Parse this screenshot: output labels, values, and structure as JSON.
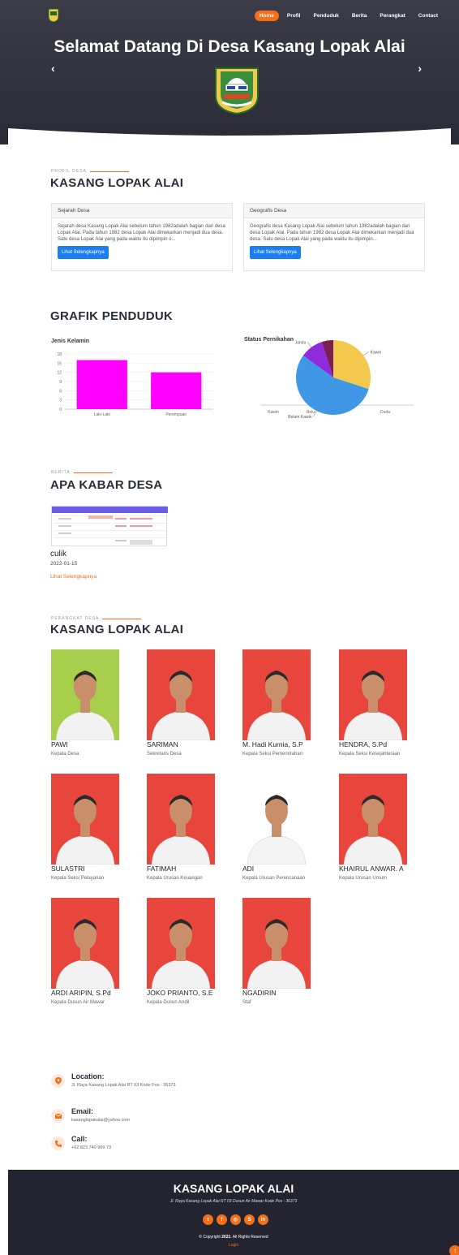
{
  "nav": {
    "items": [
      "Home",
      "Profil",
      "Penduduk",
      "Berita",
      "Perangkat",
      "Contact"
    ],
    "active": "Home"
  },
  "hero": {
    "title": "Selamat Datang Di Desa Kasang Lopak Alai",
    "prev_icon": "chevron-left-icon",
    "next_icon": "chevron-right-icon"
  },
  "profil": {
    "subtitle": "PROFIL DESA",
    "title": "KASANG LOPAK ALAI",
    "cards": [
      {
        "header": "Sejarah Desa",
        "text": "Sejarah desa Kasang Lopak Alai sebelum tahun 1982adalah bagian dari desa Lopak Alai. Pada tahun 1982 desa Lopak Alai dimekarkan menjadi dua desa. Satu desa Lopak Alai yang pada waktu itu dipimpin o...",
        "button": "Lihat Selengkapnya"
      },
      {
        "header": "Geografis Desa",
        "text": "Geografis desa Kasang Lopak Alai sebelum tahun 1982adalah bagian dari desa Lopak Alai. Pada tahun 1982 desa Lopak Alai dimekarkan menjadi dua desa. Satu desa Lopak Alai yang pada waktu itu dipimpin...",
        "button": "Lihat Selengkapnya"
      }
    ]
  },
  "grafik": {
    "title": "GRAFIK PENDUDUK"
  },
  "chart_data": [
    {
      "type": "bar",
      "title": "Jenis Kelamin",
      "categories": [
        "Laki-Laki",
        "Perempuan"
      ],
      "values": [
        16,
        12
      ],
      "ylim": [
        0,
        18
      ],
      "yticks": [
        0,
        3,
        6,
        9,
        12,
        15,
        18
      ],
      "color": "#ff00ff"
    },
    {
      "type": "pie",
      "title": "Status Pernikahan",
      "labels": [
        "Kawin",
        "Belum Kawin",
        "Janda",
        "Duda"
      ],
      "values": [
        30,
        55,
        10,
        5
      ],
      "colors": [
        "#f2c94c",
        "#3f97e6",
        "#8f2bdc",
        "#7a1f52"
      ],
      "axis_labels": [
        "Kawin",
        "Belu",
        "Duda"
      ]
    }
  ],
  "berita": {
    "subtitle": "BERITA",
    "title": "APA KABAR DESA",
    "item": {
      "title": "culik",
      "date": "2022-01-15",
      "more": "Lihat Selengkapnya"
    }
  },
  "perangkat": {
    "subtitle": "PERANGKAT DESA",
    "title": "KASANG LOPAK ALAI",
    "staff": [
      {
        "name": "PAWI",
        "role": "Kepala Desa",
        "bg": "#a7cf4b"
      },
      {
        "name": "SARIMAN",
        "role": "Sekretaris Desa",
        "bg": "#e8453c"
      },
      {
        "name": "M. Hadi Kurnia, S.P",
        "role": "Kepala Seksi Pemerintahan",
        "bg": "#e8453c"
      },
      {
        "name": "HENDRA, S.Pd",
        "role": "Kepala Seksi Kesejahteraan",
        "bg": "#e8453c"
      },
      {
        "name": "SULASTRI",
        "role": "Kepala Seksi Pelayanan",
        "bg": "#e8453c"
      },
      {
        "name": "FATIMAH",
        "role": "Kepala Urusan Keuangan",
        "bg": "#e8453c"
      },
      {
        "name": "ADI",
        "role": "Kepala Urusan Perencanaan",
        "bg": "#ffffff"
      },
      {
        "name": "KHAIRUL ANWAR. A",
        "role": "Kepala Urusan Umum",
        "bg": "#e8453c"
      },
      {
        "name": "ARDI ARIPIN, S.Pd",
        "role": "Kepala Dusun Air Mawar",
        "bg": "#e8453c"
      },
      {
        "name": "JOKO PRIANTO, S.E",
        "role": "Kepala Dusun Andil",
        "bg": "#e8453c"
      },
      {
        "name": "NGADIRIN",
        "role": "Staf",
        "bg": "#e8453c"
      }
    ]
  },
  "contact": {
    "location_label": "Location:",
    "location_value": "Jl. Raya Kasang Lopak Alai RT 03 Kode Pos : 36373",
    "email_label": "Email:",
    "email_value": "kasanglopakalai@yahoo.com",
    "call_label": "Call:",
    "call_value": "+62 823 740 969 73"
  },
  "footer": {
    "title": "KASANG LOPAK ALAI",
    "address": "Jl. Raya Kasang Lopak Alai RT 03 Dusun Air Mawar Kode Pos : 36373",
    "socials": [
      "twitter-icon",
      "facebook-icon",
      "instagram-icon",
      "skype-icon",
      "linkedin-icon"
    ],
    "copyright_prefix": "© Copyright",
    "copyright_year": "2021",
    "copyright_suffix": ". All Rights Reserved",
    "login": "Login",
    "totop_icon": "arrow-up-icon"
  }
}
